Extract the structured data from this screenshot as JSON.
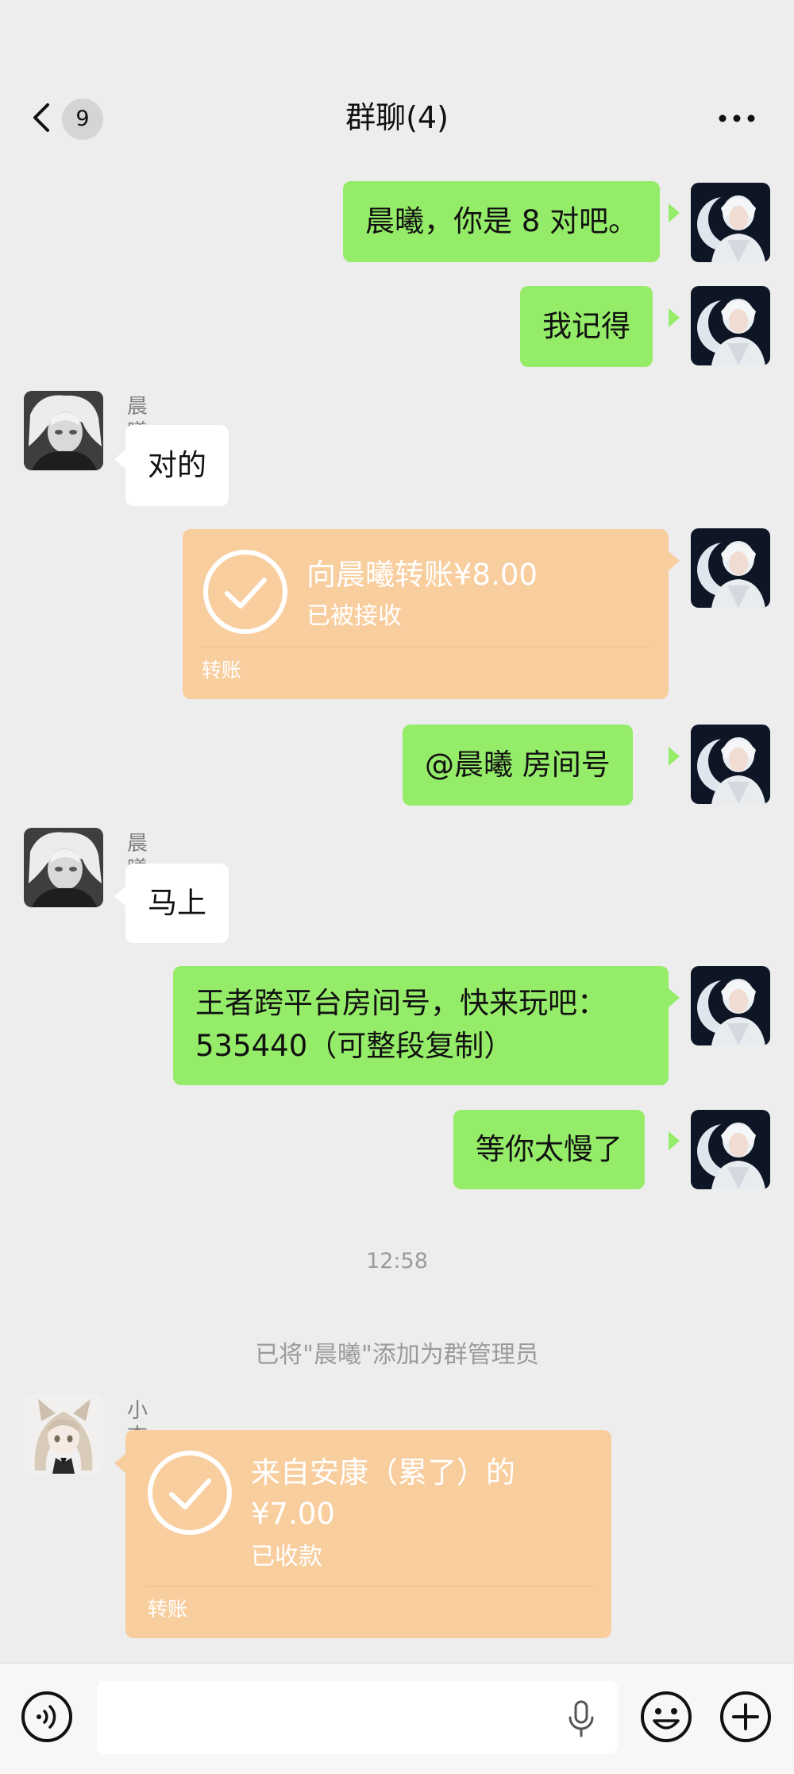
{
  "header": {
    "back_icon": "chevron-left-icon",
    "unread_count": "9",
    "title": "群聊(4)",
    "more_icon": "more-dots-icon"
  },
  "messages": [
    {
      "side": "right",
      "type": "text",
      "text": "晨曦，你是 8 对吧。"
    },
    {
      "side": "right",
      "type": "text",
      "text": "我记得"
    },
    {
      "side": "left",
      "type": "text",
      "sender": "晨曦",
      "text": "对的"
    },
    {
      "side": "right",
      "type": "transfer",
      "title": "向晨曦转账¥8.00",
      "status": "已被接收",
      "footer": "转账"
    },
    {
      "side": "right",
      "type": "text",
      "text": "@晨曦  房间号"
    },
    {
      "side": "left",
      "type": "text",
      "sender": "晨曦",
      "text": "马上"
    },
    {
      "side": "right",
      "type": "text",
      "lines": [
        "王者跨平台房间号，快来玩吧：",
        "535440（可整段复制）"
      ]
    },
    {
      "side": "right",
      "type": "text",
      "text": "等你太慢了"
    },
    {
      "side": "left",
      "type": "transfer",
      "sender": "小杏",
      "lines": [
        "来自安康（累了）的",
        "¥7.00"
      ],
      "status": "已收款",
      "footer": "转账"
    }
  ],
  "timestamp": "12:58",
  "system_message": "已将\"晨曦\"添加为群管理员",
  "input_bar": {
    "voice_icon": "voice-icon",
    "mic_icon": "microphone-icon",
    "emoji_icon": "emoji-icon",
    "plus_icon": "plus-icon"
  },
  "colors": {
    "background": "#ededed",
    "my_bubble": "#95ec69",
    "their_bubble": "#ffffff",
    "transfer_card": "#f9ce9f"
  }
}
